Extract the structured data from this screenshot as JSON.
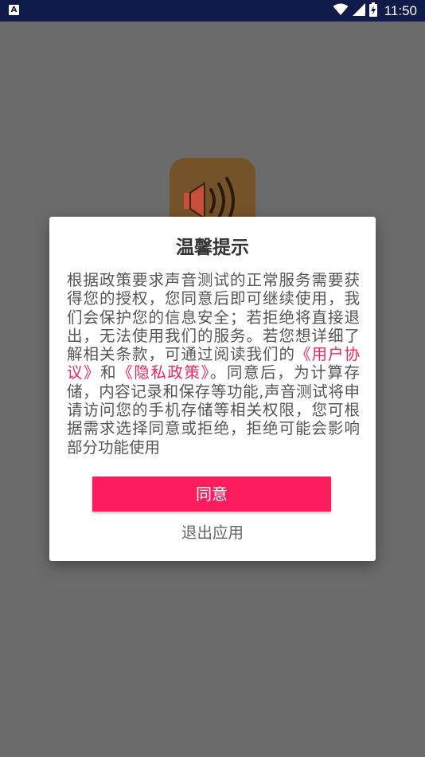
{
  "status_bar": {
    "time": "11:50",
    "notification_icon_letter": "A",
    "icons": [
      "notification-a-icon",
      "wifi-icon",
      "cell-signal-icon",
      "battery-charging-icon"
    ],
    "background_color": "#101b4a"
  },
  "app": {
    "icon": "speaker-volume-icon",
    "icon_color": "#75532a"
  },
  "dialog": {
    "title": "温馨提示",
    "body_before_links": "根据政策要求声音测试的正常服务需要获得您的授权，您同意后即可继续使用，我们会保护您的信息安全；若拒绝将直接退出，无法使用我们的服务。若您想详细了解相关条款，可通过阅读我们的",
    "user_agreement_link": "《用户协议》",
    "between_links": "和",
    "privacy_policy_link": "《隐私政策》",
    "body_after_links": "。同意后，为计算存储，内容记录和保存等功能,声音测试将申请访问您的手机存储等相关权限，您可根据需求选择同意或拒绝，拒绝可能会影响部分功能使用",
    "agree_label": "同意",
    "exit_label": "退出应用",
    "accent_color": "#fe1d5c",
    "link_color": "#f0265a"
  }
}
